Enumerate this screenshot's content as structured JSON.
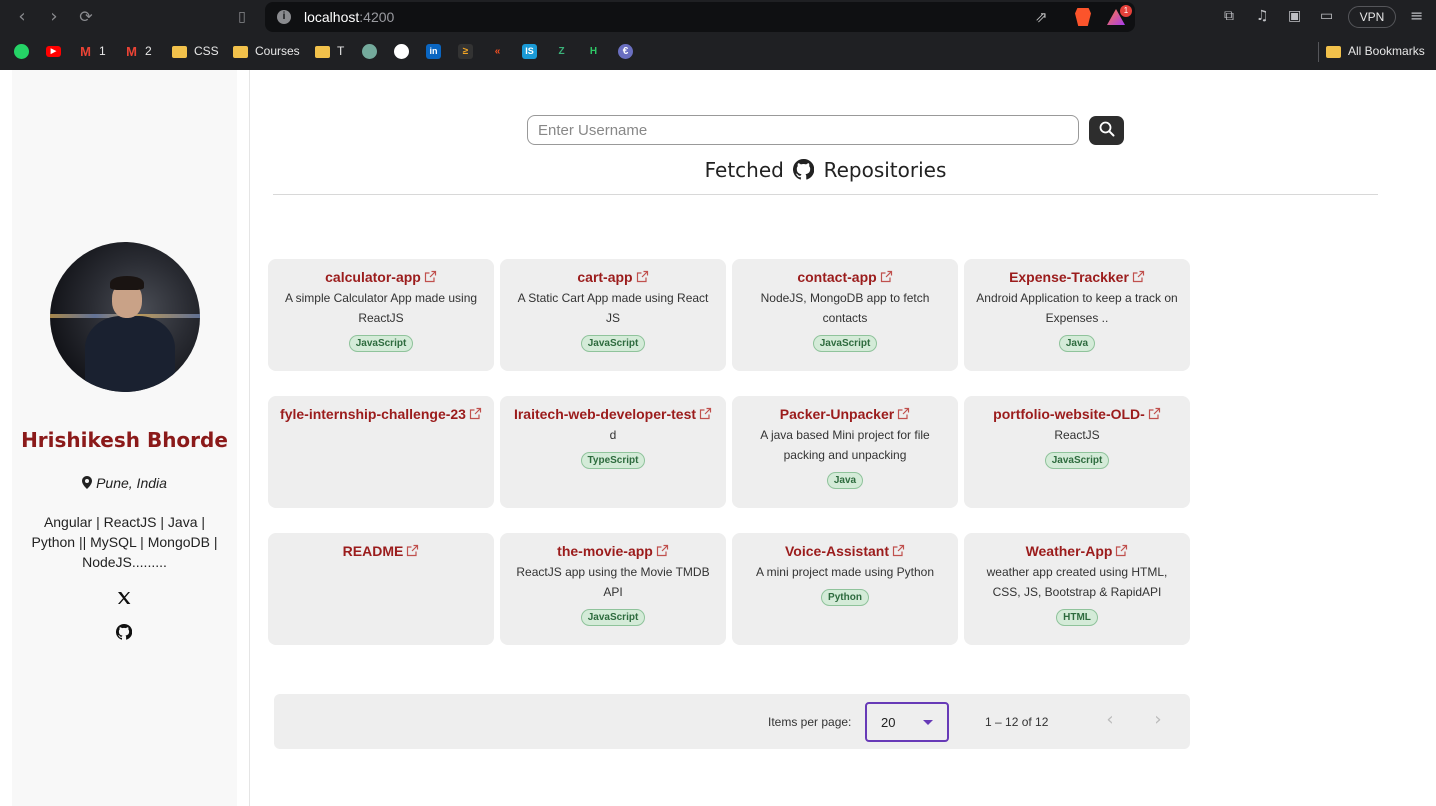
{
  "browser": {
    "url_host": "localhost",
    "url_port": ":4200",
    "vpn_label": "VPN",
    "rewards_count": "1",
    "bookmarks": [
      {
        "label": "",
        "icon": "whatsapp-icon",
        "color": "#25d366"
      },
      {
        "label": "",
        "icon": "youtube-icon",
        "color": "#ff0000"
      },
      {
        "label": "1",
        "icon": "gmail-icon",
        "color": "#ea4335"
      },
      {
        "label": "2",
        "icon": "gmail-icon",
        "color": "#ea4335"
      },
      {
        "label": "CSS",
        "icon": "folder-icon"
      },
      {
        "label": "Courses",
        "icon": "folder-icon"
      },
      {
        "label": "T",
        "icon": "folder-icon"
      }
    ],
    "all_bookmarks": "All Bookmarks"
  },
  "profile": {
    "name": "Hrishikesh Bhorde",
    "location": "Pune, India",
    "bio": "Angular | ReactJS | Java | Python || MySQL | MongoDB | NodeJS........."
  },
  "search": {
    "placeholder": "Enter Username"
  },
  "heading": {
    "before": "Fetched",
    "after": "Repositories"
  },
  "repos": [
    {
      "name": "calculator-app",
      "desc": "A simple Calculator App made using ReactJS",
      "lang": "JavaScript"
    },
    {
      "name": "cart-app",
      "desc": "A Static Cart App made using React JS",
      "lang": "JavaScript"
    },
    {
      "name": "contact-app",
      "desc": "NodeJS, MongoDB app to fetch contacts",
      "lang": "JavaScript"
    },
    {
      "name": "Expense-Trackker",
      "desc": "Android Application to keep a track on Expenses ..",
      "lang": "Java"
    },
    {
      "name": "fyle-internship-challenge-23",
      "desc": "",
      "lang": ""
    },
    {
      "name": "Iraitech-web-developer-test",
      "desc": "d",
      "lang": "TypeScript"
    },
    {
      "name": "Packer-Unpacker",
      "desc": "A java based Mini project for file packing and unpacking",
      "lang": "Java"
    },
    {
      "name": "portfolio-website-OLD-",
      "desc": "ReactJS",
      "lang": "JavaScript"
    },
    {
      "name": "README",
      "desc": "",
      "lang": ""
    },
    {
      "name": "the-movie-app",
      "desc": "ReactJS app using the Movie TMDB API",
      "lang": "JavaScript"
    },
    {
      "name": "Voice-Assistant",
      "desc": "A mini project made using Python",
      "lang": "Python"
    },
    {
      "name": "Weather-App",
      "desc": "weather app created using HTML, CSS, JS, Bootstrap & RapidAPI",
      "lang": "HTML"
    }
  ],
  "paginator": {
    "items_per_page_label": "Items per page:",
    "items_per_page": "20",
    "range_label": "1 – 12 of 12"
  }
}
